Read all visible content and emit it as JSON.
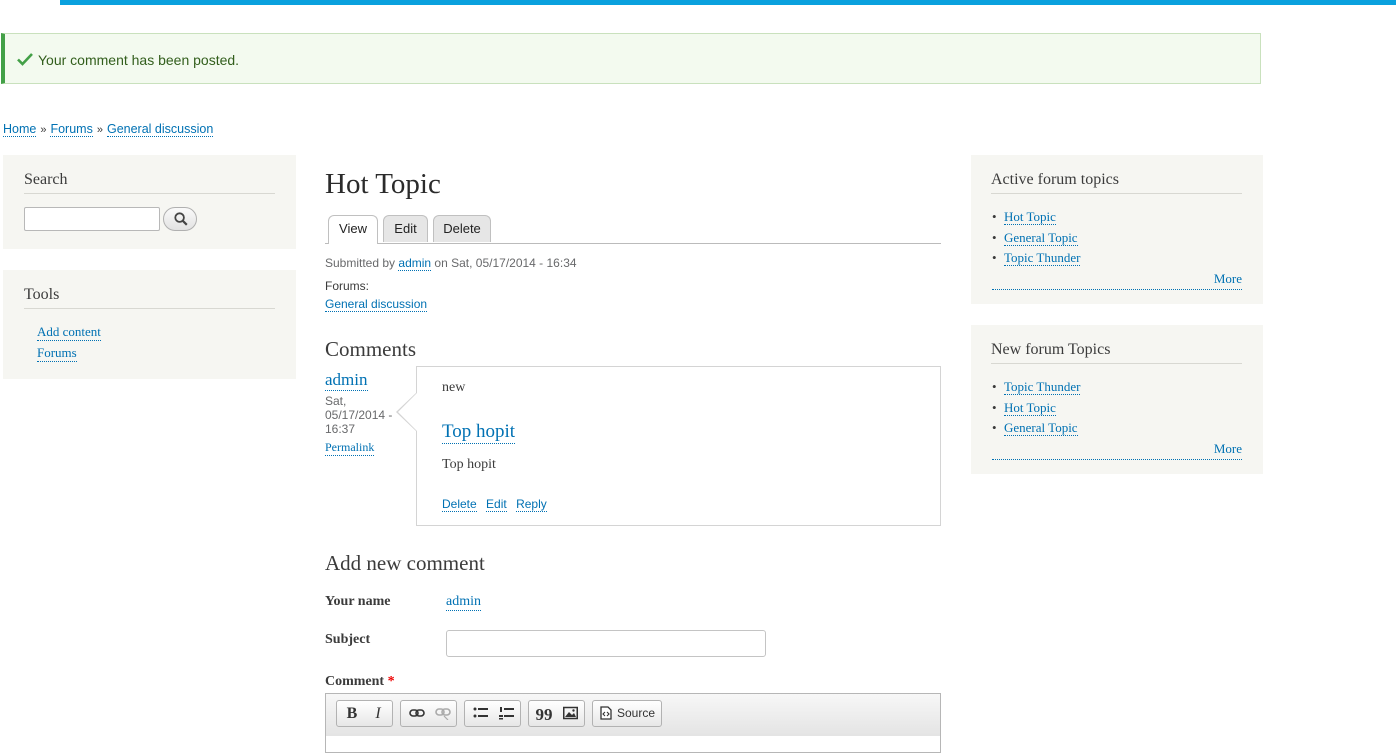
{
  "status": {
    "message": "Your comment has been posted."
  },
  "breadcrumb": {
    "items": [
      "Home",
      "Forums",
      "General discussion"
    ],
    "separator": "»"
  },
  "search_block": {
    "title": "Search"
  },
  "tools_block": {
    "title": "Tools",
    "links": [
      "Add content",
      "Forums"
    ]
  },
  "active_topics": {
    "title": "Active forum topics",
    "items": [
      "Hot Topic",
      "General Topic",
      "Topic Thunder"
    ],
    "more": "More"
  },
  "new_topics": {
    "title": "New forum Topics",
    "items": [
      "Topic Thunder",
      "Hot Topic",
      "General Topic"
    ],
    "more": "More"
  },
  "node": {
    "title": "Hot Topic",
    "tabs": [
      "View",
      "Edit",
      "Delete"
    ],
    "submitted_prefix": "Submitted by",
    "submitted_author": "admin",
    "submitted_suffix": "on Sat, 05/17/2014 - 16:34",
    "forums_label": "Forums:",
    "forum_link": "General discussion"
  },
  "comments": {
    "heading": "Comments",
    "items": [
      {
        "author": "admin",
        "date": "Sat, 05/17/2014 - 16:37",
        "permalink": "Permalink",
        "mark": "new",
        "subject": "Top hopit",
        "body": "Top hopit",
        "links": [
          "Delete",
          "Edit",
          "Reply"
        ]
      }
    ]
  },
  "comment_form": {
    "heading": "Add new comment",
    "name_label": "Your name",
    "name_value": "admin",
    "subject_label": "Subject",
    "subject_value": "",
    "comment_label": "Comment",
    "required_marker": "*",
    "toolbar": {
      "bold": "B",
      "italic": "I",
      "link_icon": "link-icon",
      "unlink_icon": "unlink-icon",
      "bullet_icon": "bulleted-list-icon",
      "numbered_icon": "numbered-list-icon",
      "quote": "99",
      "image_icon": "image-icon",
      "source": "Source"
    }
  },
  "colors": {
    "accent": "#0aa1de",
    "link": "#0071b3",
    "status_green": "#43a047",
    "sidebar_bg": "#f6f6f2"
  }
}
